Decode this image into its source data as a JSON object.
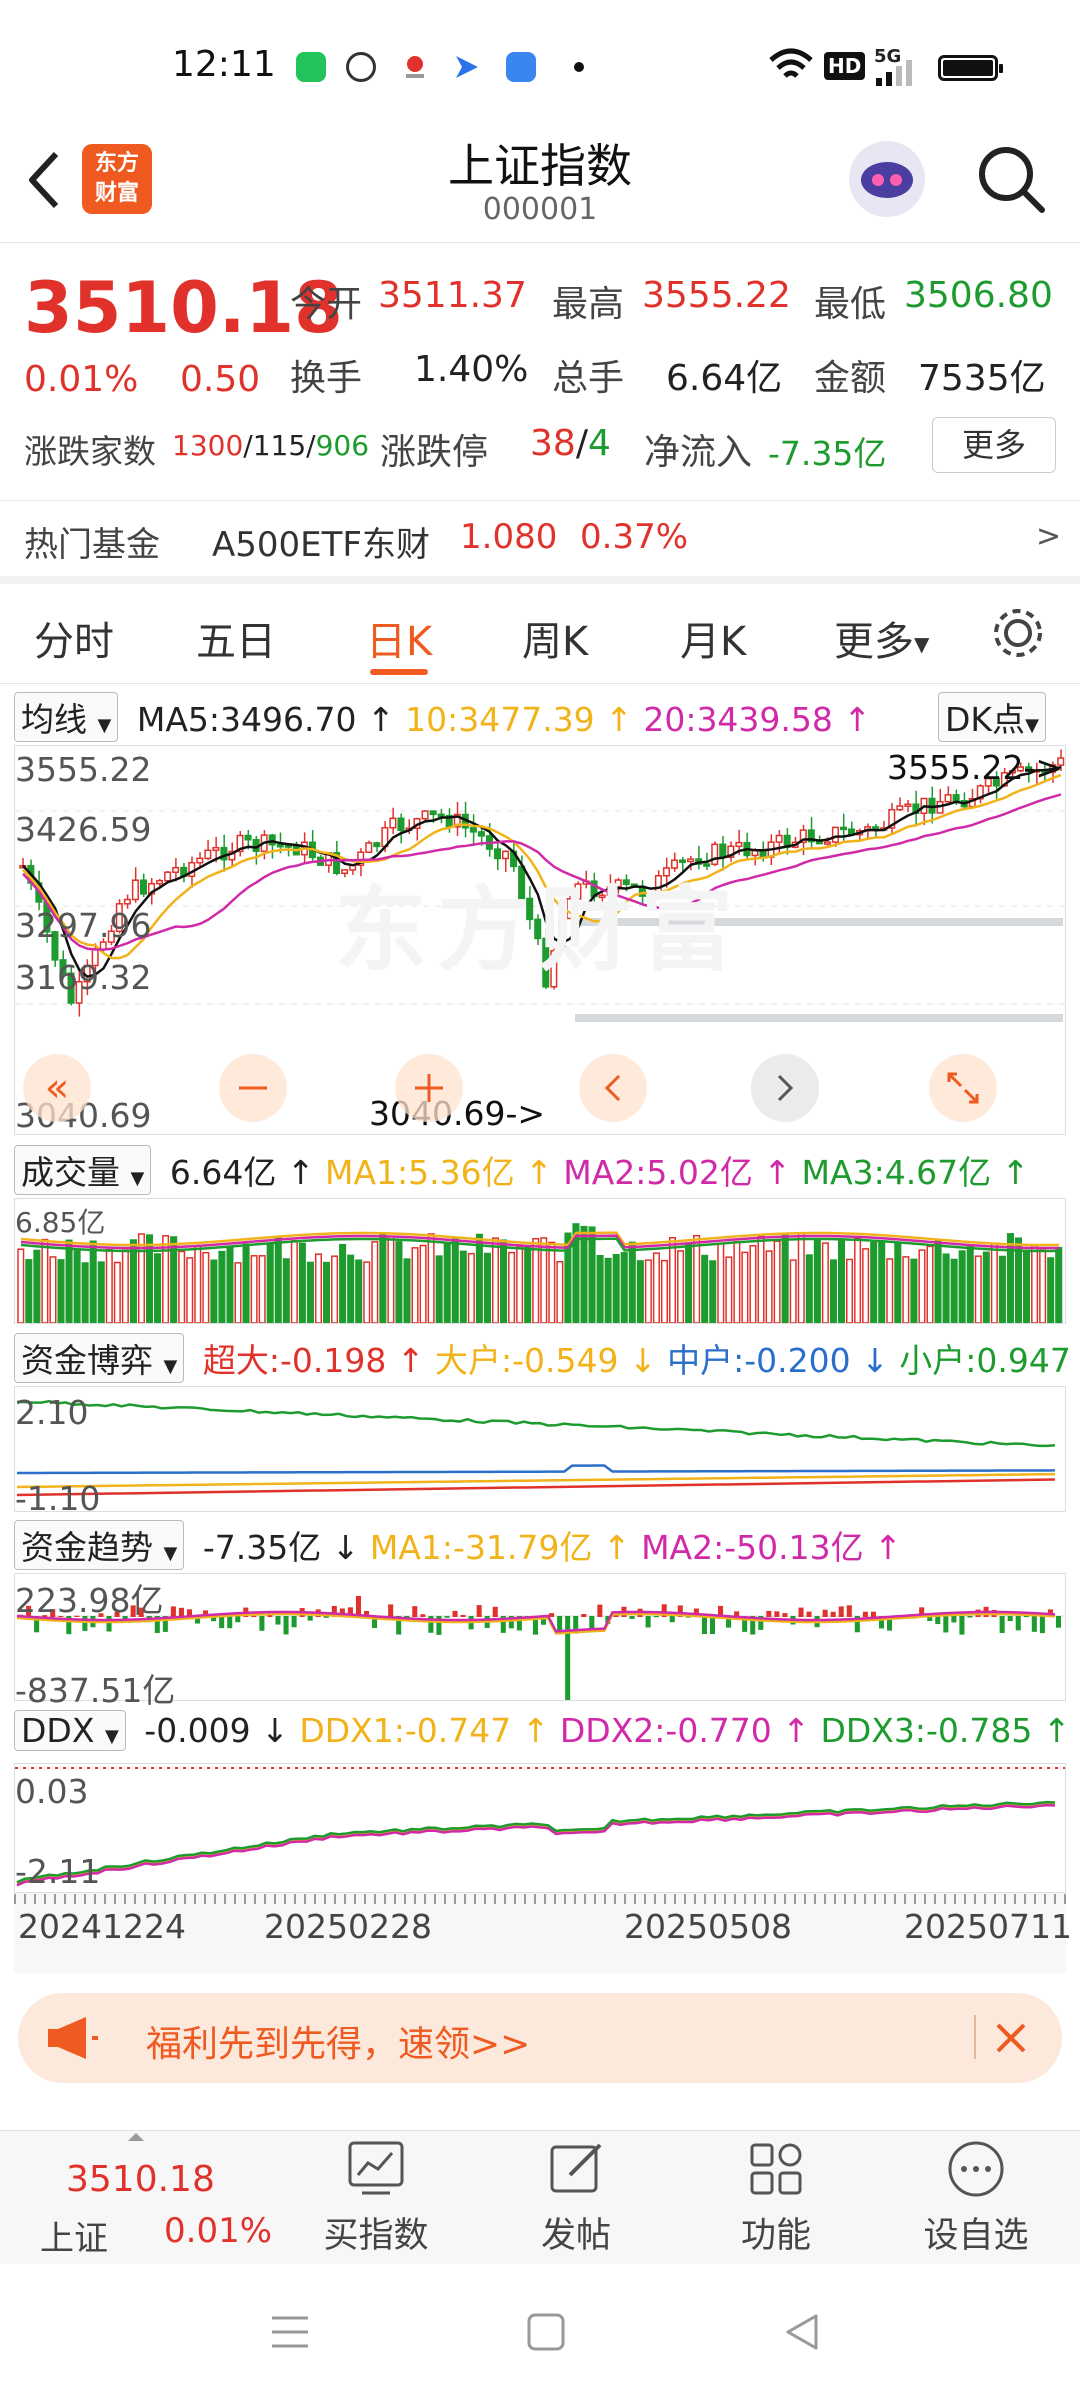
{
  "status_bar": {
    "time": "12:11",
    "hd": "HD",
    "signal": "5G"
  },
  "header": {
    "logo_text": "东方\n财富",
    "title": "上证指数",
    "code": "000001"
  },
  "quote": {
    "price": "3510.18",
    "change_pct": "0.01%",
    "change": "0.50",
    "open_label": "今开",
    "open": "3511.37",
    "high_label": "最高",
    "high": "3555.22",
    "low_label": "最低",
    "low": "3506.80",
    "turnover_label": "换手",
    "turnover": "1.40%",
    "volume_label": "总手",
    "volume": "6.64亿",
    "amount_label": "金额",
    "amount": "7535亿",
    "advdec_label": "涨跌家数",
    "adv": "1300",
    "flat": "115",
    "dec": "906",
    "limit_label": "涨跌停",
    "limit_up": "38",
    "limit_down": "4",
    "netflow_label": "净流入",
    "netflow": "-7.35亿",
    "more": "更多"
  },
  "hot_fund": {
    "label": "热门基金",
    "name": "A500ETF东财",
    "price": "1.080",
    "pct": "0.37%",
    "arrow": ">"
  },
  "tabs": [
    "分时",
    "五日",
    "日K",
    "周K",
    "月K",
    "更多"
  ],
  "active_tab": "日K",
  "kline": {
    "ma_select": "均线",
    "ma5": "MA5:3496.70",
    "ma10": "10:3477.39",
    "ma20": "20:3439.58",
    "dk": "DK点",
    "y_labels": [
      "3555.22",
      "3426.59",
      "3297.96",
      "3169.32",
      "3040.69"
    ],
    "max_callout": "3555.22->",
    "min_callout": "3040.69->",
    "watermark": "东方财富"
  },
  "volume": {
    "select": "成交量",
    "value": "6.64亿",
    "ma1": "MA1:5.36亿",
    "ma2": "MA2:5.02亿",
    "ma3": "MA3:4.67亿",
    "ylabel": "6.85亿"
  },
  "fund_game": {
    "select": "资金博弈",
    "super": "超大:-0.198",
    "large": "大户:-0.549",
    "mid": "中户:-0.200",
    "small": "小户:0.947",
    "y_top": "2.10",
    "y_bot": "-1.10"
  },
  "fund_trend": {
    "select": "资金趋势",
    "value": "-7.35亿",
    "ma1": "MA1:-31.79亿",
    "ma2": "MA2:-50.13亿",
    "y_top": "223.98亿",
    "y_bot": "-837.51亿"
  },
  "ddx": {
    "select": "DDX",
    "value": "-0.009",
    "ddx1": "DDX1:-0.747",
    "ddx2": "DDX2:-0.770",
    "ddx3": "DDX3:-0.785",
    "y_top": "0.03",
    "y_bot": "-2.11"
  },
  "x_dates": [
    "20241224",
    "20250228",
    "20250508",
    "20250711"
  ],
  "promo": {
    "text": "福利先到先得，速领>>"
  },
  "bottom": {
    "price": "3510.18",
    "name": "上证",
    "pct": "0.01%",
    "buttons": [
      "买指数",
      "发帖",
      "功能",
      "设自选"
    ]
  },
  "colors": {
    "up": "#e0322b",
    "down": "#1d9b2e",
    "accent": "#ee5a1f",
    "ma10": "#f2b31a",
    "ma20": "#d02aa8"
  }
}
